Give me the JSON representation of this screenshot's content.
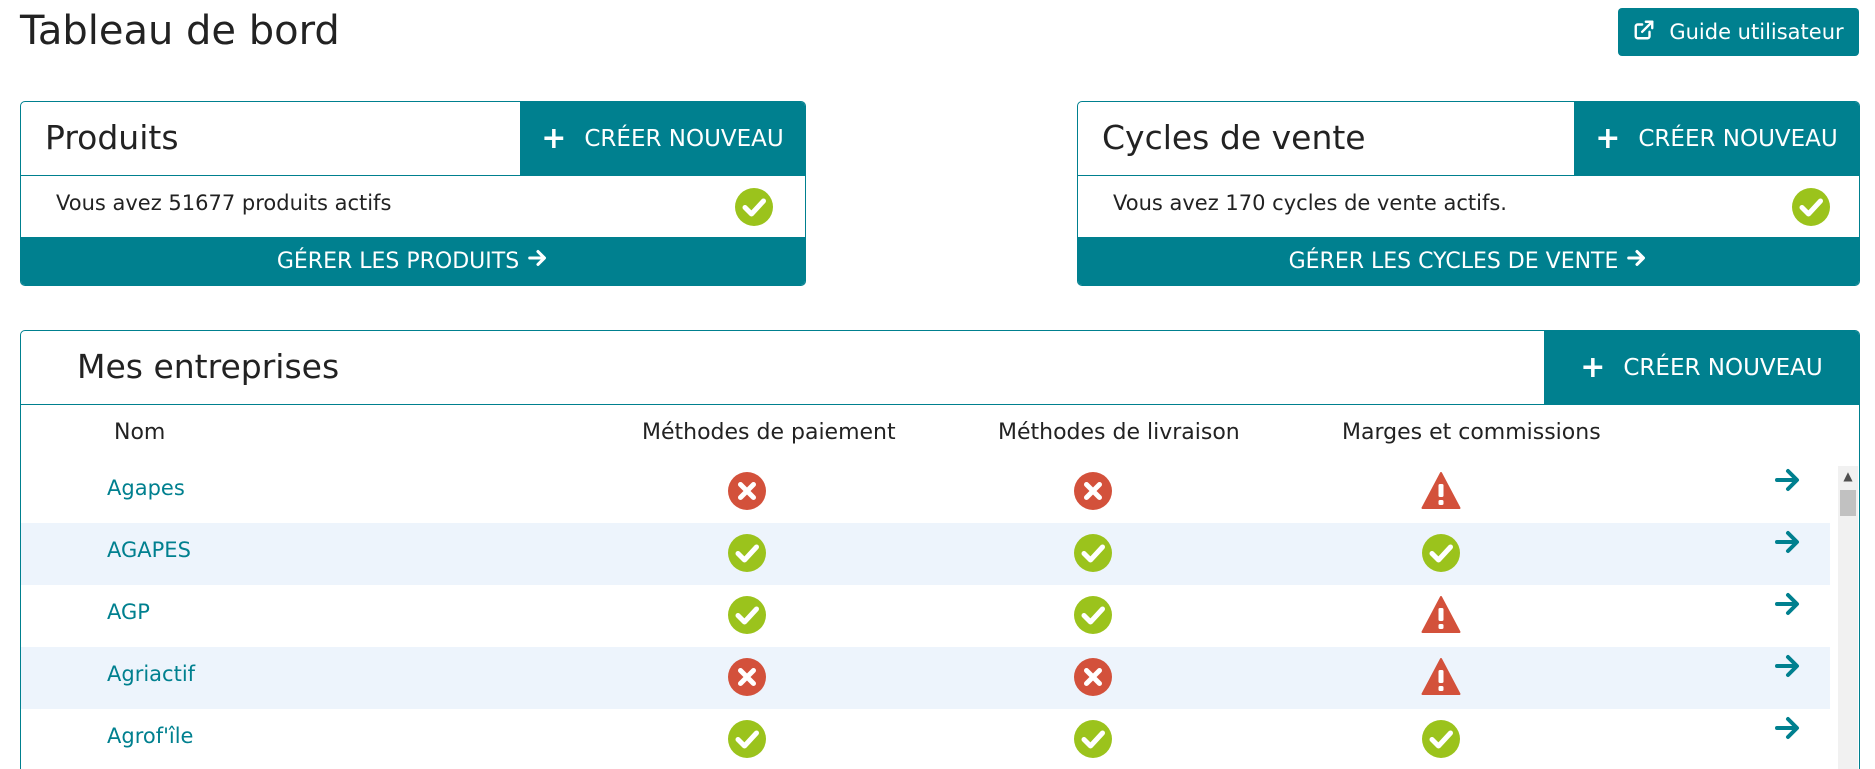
{
  "page": {
    "title": "Tableau de bord"
  },
  "guide": {
    "label": "Guide utilisateur",
    "icon": "external-link-icon"
  },
  "products": {
    "title": "Produits",
    "create_label": "CRÉER NOUVEAU",
    "summary": "Vous avez 51677 produits actifs",
    "manage_label": "GÉRER LES PRODUITS"
  },
  "sales": {
    "title": "Cycles de vente",
    "create_label": "CRÉER NOUVEAU",
    "summary": "Vous avez 170 cycles de vente actifs.",
    "manage_label": "GÉRER LES CYCLES DE VENTE"
  },
  "companies": {
    "title": "Mes entreprises",
    "create_label": "CRÉER NOUVEAU",
    "columns": {
      "name": "Nom",
      "payment": "Méthodes de paiement",
      "delivery": "Méthodes de livraison",
      "margins": "Marges et commissions"
    },
    "rows": [
      {
        "name": "Agapes",
        "payment": "error",
        "delivery": "error",
        "margins": "warning"
      },
      {
        "name": "AGAPES",
        "payment": "ok",
        "delivery": "ok",
        "margins": "ok"
      },
      {
        "name": "AGP",
        "payment": "ok",
        "delivery": "ok",
        "margins": "warning"
      },
      {
        "name": "Agriactif",
        "payment": "error",
        "delivery": "error",
        "margins": "warning"
      },
      {
        "name": "Agrof'île",
        "payment": "ok",
        "delivery": "ok",
        "margins": "ok"
      }
    ]
  },
  "colors": {
    "accent": "#00808f",
    "ok": "#9bc31c",
    "error": "#d3513b",
    "warning": "#d3513b",
    "row_alt": "#edf4fc"
  }
}
